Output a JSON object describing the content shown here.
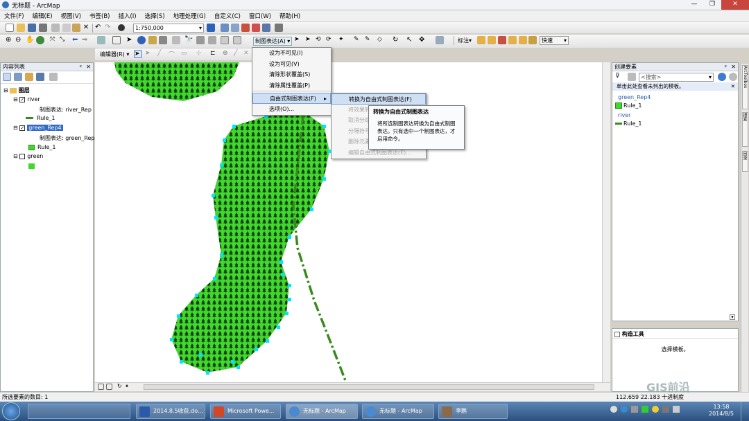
{
  "window": {
    "title": "无标题 - ArcMap"
  },
  "menubar": {
    "items": [
      "文件(F)",
      "编辑(E)",
      "视图(V)",
      "书签(B)",
      "插入(I)",
      "选择(S)",
      "地理处理(G)",
      "自定义(C)",
      "窗口(W)",
      "帮助(H)"
    ]
  },
  "toolbar": {
    "scale": "1:750,000",
    "representation_menu": "制图表达(A)",
    "label_menu": "标注",
    "speed_combo": "快速",
    "editor_menu": "编辑器(R)"
  },
  "toc": {
    "title": "内容列表",
    "root": "图层",
    "layers": [
      {
        "name": "river",
        "checked": true,
        "rep": "制图表达: river_Rep",
        "rule": "Rule_1"
      },
      {
        "name": "green_Rep4",
        "checked": true,
        "selected": true,
        "rep": "制图表达: green_Rep",
        "rule": "Rule_1"
      },
      {
        "name": "green",
        "checked": false
      }
    ]
  },
  "context_menu": {
    "items": [
      {
        "label": "设为不可见(I)",
        "enabled": true
      },
      {
        "label": "设为可见(V)",
        "enabled": true
      },
      {
        "label": "清除形状覆盖(S)",
        "enabled": true
      },
      {
        "label": "清除属性覆盖(P)",
        "enabled": true
      },
      {
        "label": "自由式制图表达(F)",
        "enabled": true,
        "highlighted": true,
        "submenu": true
      },
      {
        "label": "选项(O)...",
        "enabled": true
      }
    ]
  },
  "submenu": {
    "items": [
      {
        "label": "转换为自由式制图表达(F)",
        "enabled": true,
        "highlighted": true
      },
      {
        "label": "将效果转",
        "enabled": false
      },
      {
        "label": "取消分组",
        "enabled": false
      },
      {
        "label": "分隔符号",
        "enabled": false
      },
      {
        "label": "删除元素",
        "enabled": false
      },
      {
        "label": "编辑自由式制图表达(E)...",
        "enabled": false
      }
    ]
  },
  "tooltip": {
    "title": "转换为自由式制图表达",
    "body": "将所选制图表达转换为自由式制图表达。只有选中一个制图表达，才启用命令。"
  },
  "create_features": {
    "title": "创建要素",
    "search_placeholder": "<搜索>",
    "notice": "单击此处查看未列出的模板。",
    "groups": [
      {
        "name": "green_Rep4",
        "items": [
          "Rule_1"
        ]
      },
      {
        "name": "river",
        "items": [
          "Rule_1"
        ]
      }
    ]
  },
  "construct_tools": {
    "title": "构造工具",
    "message": "选择模板。"
  },
  "side_tabs": [
    "ArcToolbox",
    "搜索",
    "目录"
  ],
  "status": {
    "left": "所选要素的数目: 1",
    "coords": "112.659  22.183 十进制度",
    "watermark": "GIS前沿"
  },
  "taskbar": {
    "items": [
      "2014.8.5收获.do...",
      "Microsoft Powe...",
      "无标题 - ArcMap",
      "无标题 - ArcMap",
      "李鹏"
    ],
    "time": "13:58",
    "date": "2014/8/5"
  },
  "colors": {
    "polygon": "#41d82e",
    "vertex": "#00e5ff",
    "river": "#3a8a1e",
    "highlight": "#cfe0f5"
  }
}
